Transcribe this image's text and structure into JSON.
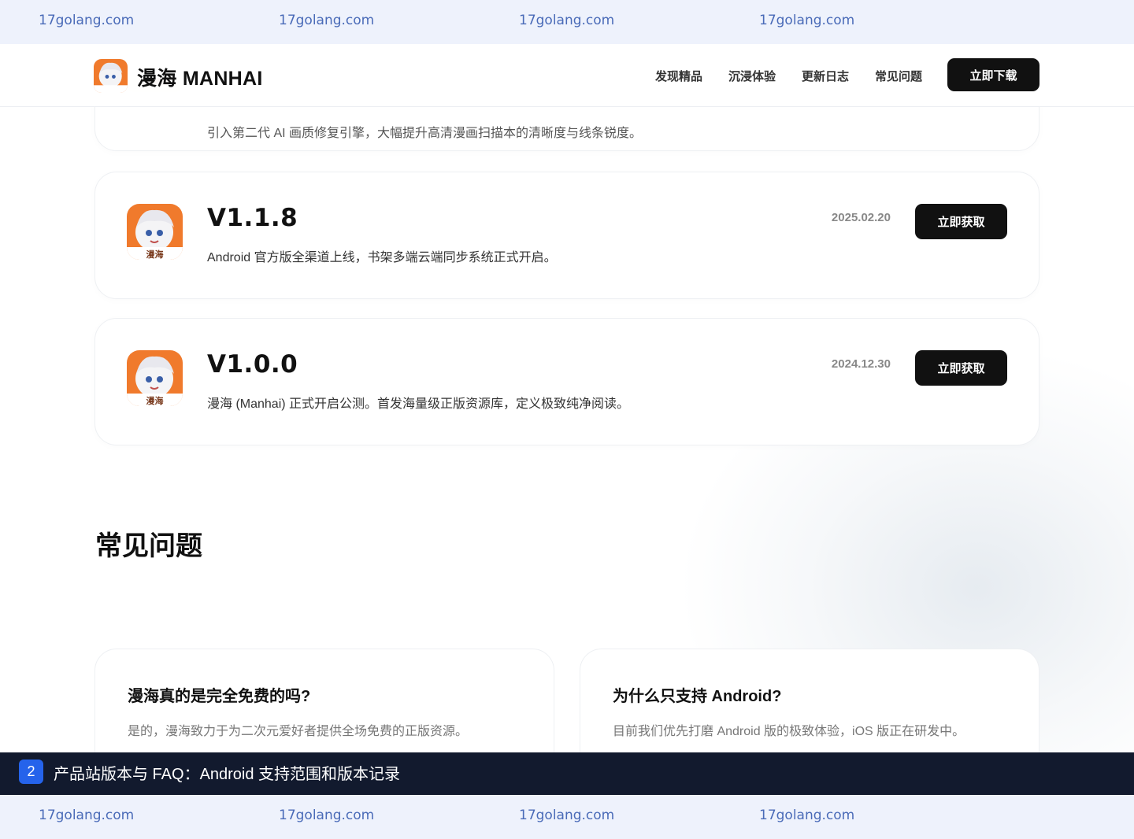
{
  "watermark": {
    "text": "17golang.com"
  },
  "header": {
    "brand": "漫海 MANHAI",
    "nav": [
      "发现精品",
      "沉浸体验",
      "更新日志",
      "常见问题"
    ],
    "download_label": "立即下载"
  },
  "partial_card": {
    "desc": "引入第二代 AI 画质修复引擎，大幅提升高清漫画扫描本的清晰度与线条锐度。"
  },
  "versions": [
    {
      "version": "V1.1.8",
      "date": "2025.02.20",
      "desc": "Android 官方版全渠道上线，书架多端云端同步系统正式开启。",
      "button": "立即获取"
    },
    {
      "version": "V1.0.0",
      "date": "2024.12.30",
      "desc": "漫海 (Manhai) 正式开启公测。首发海量级正版资源库，定义极致纯净阅读。",
      "button": "立即获取"
    }
  ],
  "app_icon_text": "漫海",
  "faq": {
    "title": "常见问题",
    "items": [
      {
        "q": "漫海真的是完全免费的吗?",
        "a": "是的，漫海致力于为二次元爱好者提供全场免费的正版资源。"
      },
      {
        "q": "为什么只支持 Android?",
        "a": "目前我们优先打磨 Android 版的极致体验，iOS 版正在研发中。"
      }
    ]
  },
  "caption": {
    "number": "2",
    "text": "产品站版本与 FAQ：Android 支持范围和版本记录"
  },
  "colors": {
    "accent_dark": "#111111",
    "watermark_bg": "#eef2fc",
    "watermark_text": "#4a6bb8",
    "caption_bg": "#121a2e",
    "caption_badge": "#2563eb",
    "icon_orange": "#f07a2c"
  }
}
